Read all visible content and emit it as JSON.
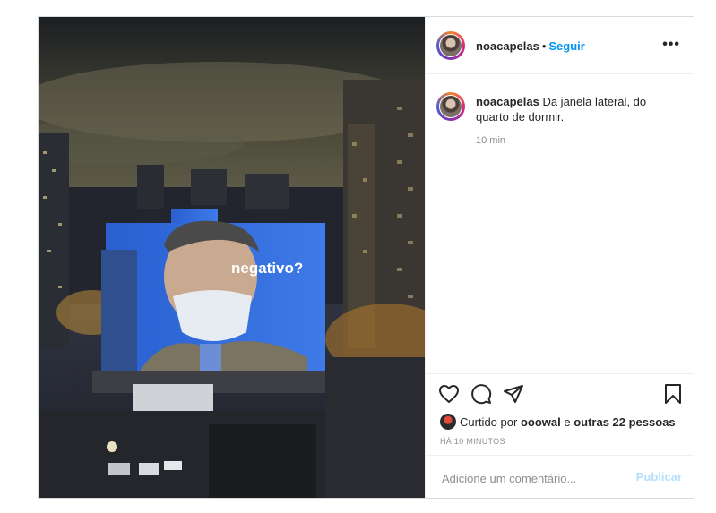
{
  "post": {
    "username": "noacapelas",
    "separator": "•",
    "follow_label": "Seguir",
    "more_label": "•••",
    "caption_text": "Da janela lateral, do quarto de dormir.",
    "caption_time": "10 min",
    "liked_prefix": "Curtido por",
    "liked_user": "ooowal",
    "liked_conj": "e",
    "liked_others": "outras 22 pessoas",
    "time_ago": "HÁ 10 MINUTOS",
    "comment_placeholder": "Adicione um comentário...",
    "publish_label": "Publicar",
    "photo_overlay_text": "negativo?"
  },
  "icons": {
    "like": "heart-icon",
    "comment": "comment-bubble-icon",
    "share": "paper-plane-icon",
    "save": "bookmark-icon",
    "more": "more-options-icon"
  },
  "colors": {
    "link_blue": "#0095f6",
    "publish_disabled": "#b2dffc",
    "muted": "#8e8e8e"
  }
}
